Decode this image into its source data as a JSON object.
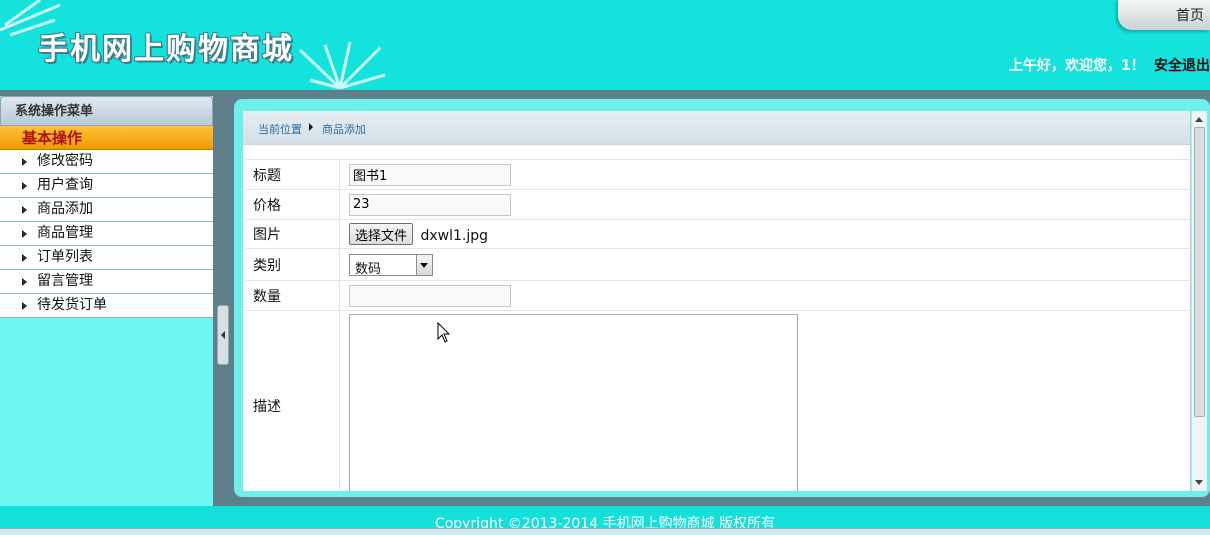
{
  "header": {
    "logo_text": "手机网上购物商城",
    "home_tab": "首页",
    "greeting": "上午好，欢迎您，1！",
    "logout": "安全退出"
  },
  "sidebar": {
    "menu_title": "系统操作菜单",
    "group_title": "基本操作",
    "items": [
      {
        "label": "修改密码"
      },
      {
        "label": "用户查询"
      },
      {
        "label": "商品添加"
      },
      {
        "label": "商品管理"
      },
      {
        "label": "订单列表"
      },
      {
        "label": "留言管理"
      },
      {
        "label": "待发货订单"
      }
    ]
  },
  "breadcrumb": {
    "label": "当前位置",
    "current": "商品添加"
  },
  "form": {
    "title_label": "标题",
    "title_value": "图书1",
    "price_label": "价格",
    "price_value": "23",
    "image_label": "图片",
    "file_button": "选择文件",
    "file_name": "dxwl1.jpg",
    "category_label": "类别",
    "category_value": "数码",
    "quantity_label": "数量",
    "quantity_value": "",
    "description_label": "描述",
    "description_value": ""
  },
  "footer": {
    "copyright": "Copyright ©2013-2014 手机网上购物商城 版权所有"
  },
  "colors": {
    "page_bg": "#15dfd9",
    "sidebar_bg": "#6df5f1",
    "group_title_bg": "#f5aa10",
    "frame_border": "#5f7f8a"
  }
}
